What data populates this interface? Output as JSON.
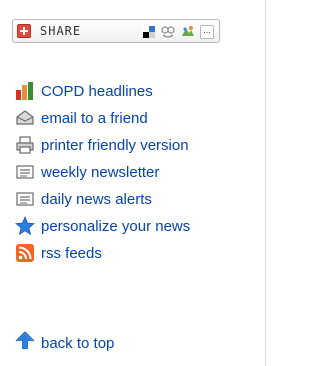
{
  "share": {
    "label": "SHARE",
    "plus_icon": "addthis-plus-icon",
    "services": [
      {
        "name": "delicious-icon"
      },
      {
        "name": "digg-icon"
      },
      {
        "name": "myspace-icon"
      },
      {
        "name": "more-services-icon",
        "label": "..."
      }
    ],
    "accent_color": "#e2473e"
  },
  "links": [
    {
      "label": "COPD headlines",
      "icon": "bar-chart-icon"
    },
    {
      "label": "email to a friend",
      "icon": "envelope-icon"
    },
    {
      "label": "printer friendly version",
      "icon": "printer-icon"
    },
    {
      "label": "weekly newsletter",
      "icon": "newsletter-icon"
    },
    {
      "label": "daily news alerts",
      "icon": "alerts-icon"
    },
    {
      "label": "personalize your news",
      "icon": "star-icon"
    },
    {
      "label": "rss feeds",
      "icon": "rss-icon"
    }
  ],
  "back_to_top": {
    "label": "back to top",
    "icon": "up-arrow-icon"
  },
  "colors": {
    "link": "#0645ad",
    "star": "#2a7de1",
    "rss": "#f26522"
  }
}
